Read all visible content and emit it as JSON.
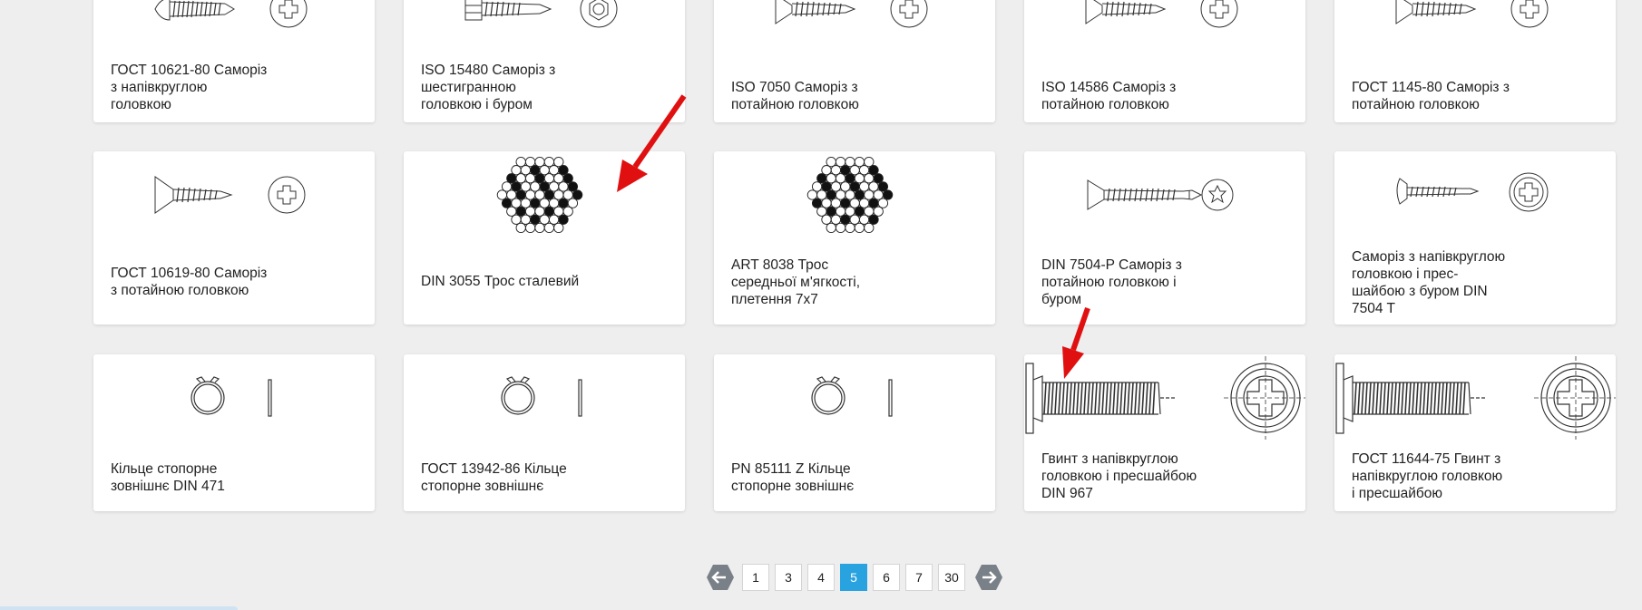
{
  "grid": {
    "rows": [
      [
        {
          "title": "ГОСТ 10621-80 Саморіз з напівкруглою головкою",
          "drawing": "round-head-screw",
          "lines": [
            "ГОСТ 10621-80 Саморіз",
            "з напівкруглою",
            "головкою"
          ]
        },
        {
          "title": "ISO 15480 Саморіз з шестигранною головкою і буром",
          "drawing": "hex-head-drill-screw",
          "lines": [
            "ISO 15480 Саморіз з",
            "шестигранною",
            "головкою і буром"
          ]
        },
        {
          "title": "ISO 7050 Саморіз з потайною головкою",
          "drawing": "countersunk-screw",
          "lines": [
            "ISO 7050 Саморіз з",
            "потайною головкою"
          ]
        },
        {
          "title": "ISO 14586 Саморіз з потайною головкою",
          "drawing": "countersunk-screw",
          "lines": [
            "ISO 14586 Саморіз з",
            "потайною головкою"
          ]
        },
        {
          "title": "ГОСТ 1145-80 Саморіз з потайною головкою",
          "drawing": "countersunk-screw",
          "lines": [
            "ГОСТ 1145-80 Саморіз з",
            "потайною головкою"
          ]
        }
      ],
      [
        {
          "title": "ГОСТ 10619-80 Саморіз з потайною головкою",
          "drawing": "countersunk-screw",
          "lines": [
            "ГОСТ 10619-80 Саморіз",
            "з потайною головкою"
          ]
        },
        {
          "title": "DIN 3055 Трос сталевий",
          "drawing": "wire-rope",
          "lines": [
            "DIN 3055 Трос сталевий"
          ]
        },
        {
          "title": "ART 8038 Трос середньої м'ягкості, плетення 7x7",
          "drawing": "wire-rope",
          "lines": [
            "ART 8038 Трос",
            "середньої м'ягкості,",
            "плетення 7x7"
          ]
        },
        {
          "title": "DIN 7504-P Саморіз з потайною головкою і буром",
          "drawing": "countersunk-drill-screw",
          "lines": [
            "DIN 7504-P Саморіз з",
            "потайною головкою і",
            "буром"
          ]
        },
        {
          "title": "Саморіз з напівкруглою головкою і прес-шайбою з буром DIN 7504 T",
          "drawing": "washer-drill-screw",
          "lines": [
            "Саморіз з напівкруглою",
            "головкою і прес-",
            "шайбою з буром DIN",
            "7504 T"
          ]
        }
      ],
      [
        {
          "title": "Кільце стопорне зовнішнє DIN 471",
          "drawing": "retaining-ring",
          "lines": [
            "Кільце стопорне",
            "зовнішнє DIN 471"
          ]
        },
        {
          "title": "ГОСТ 13942-86 Кільце стопорне зовнішнє",
          "drawing": "retaining-ring",
          "lines": [
            "ГОСТ 13942-86 Кільце",
            "стопорне зовнішнє"
          ]
        },
        {
          "title": "PN 85111 Z Кільце стопорне зовнішнє",
          "drawing": "retaining-ring",
          "lines": [
            "PN 85111 Z Кільце",
            "стопорне зовнішнє"
          ]
        },
        {
          "title": "Гвинт з напівкруглою головкою і пресшайбою DIN 967",
          "drawing": "washer-bolt-large",
          "lines": [
            "Гвинт з напівкруглою",
            "головкою і пресшайбою",
            "DIN 967"
          ]
        },
        {
          "title": "ГОСТ 11644-75 Гвинт з напівкруглою головкою і пресшайбою",
          "drawing": "washer-bolt-large",
          "lines": [
            "ГОСТ 11644-75 Гвинт з",
            "напівкруглою головкою",
            "і пресшайбою"
          ]
        }
      ]
    ]
  },
  "annotations": [
    {
      "name": "red-arrow-pointing-wire-rope",
      "color": "#e01010"
    },
    {
      "name": "red-arrow-pointing-screw",
      "color": "#e01010"
    }
  ],
  "pagination": {
    "prev_icon": "arrow-left-icon",
    "next_icon": "arrow-right-icon",
    "pages": [
      "1",
      "3",
      "4",
      "5",
      "6",
      "7",
      "30"
    ],
    "current": "5"
  },
  "colors": {
    "accent": "#29a3e0",
    "arrow_bg": "#7a8088",
    "annotation": "#e01010"
  }
}
